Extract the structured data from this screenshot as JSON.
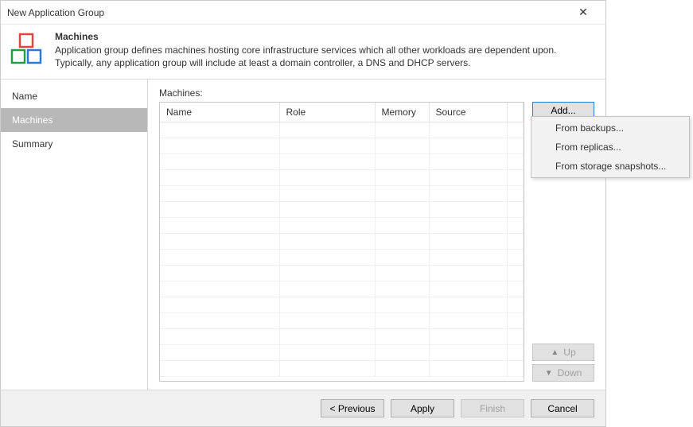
{
  "titlebar": {
    "title": "New Application Group"
  },
  "header": {
    "title": "Machines",
    "description": "Application group defines machines hosting core infrastructure services which all other workloads are dependent upon. Typically, any application group will include at least a domain controller, a DNS and DHCP servers."
  },
  "sidebar": {
    "items": [
      {
        "label": "Name"
      },
      {
        "label": "Machines"
      },
      {
        "label": "Summary"
      }
    ],
    "selected_index": 1
  },
  "main": {
    "label": "Machines:",
    "columns": [
      "Name",
      "Role",
      "Memory",
      "Source"
    ],
    "rows": [],
    "side_buttons": {
      "add": "Add...",
      "up": "Up",
      "down": "Down"
    },
    "dropdown": {
      "items": [
        "From backups...",
        "From replicas...",
        "From storage snapshots..."
      ]
    }
  },
  "footer": {
    "previous": "< Previous",
    "apply": "Apply",
    "finish": "Finish",
    "cancel": "Cancel"
  }
}
